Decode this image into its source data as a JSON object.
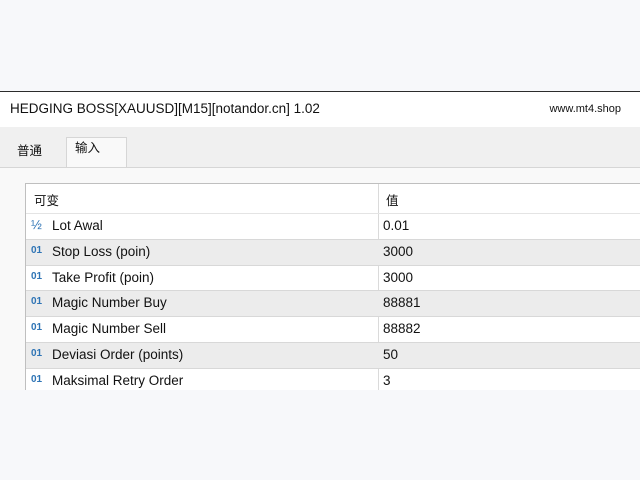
{
  "window": {
    "title": "HEDGING BOSS[XAUUSD][M15][notandor.cn] 1.02",
    "site": "www.mt4.shop"
  },
  "tabs": [
    {
      "label": "普通",
      "active": false
    },
    {
      "label": "输入",
      "active": true
    }
  ],
  "table": {
    "headers": {
      "name": "可变",
      "value": "值"
    },
    "rows": [
      {
        "icon": "½",
        "icon_name": "fraction-icon",
        "name": "Lot Awal",
        "value": "0.01"
      },
      {
        "icon": "01",
        "icon_name": "integer-icon",
        "name": "Stop Loss (poin)",
        "value": "3000"
      },
      {
        "icon": "01",
        "icon_name": "integer-icon",
        "name": "Take Profit (poin)",
        "value": "3000"
      },
      {
        "icon": "01",
        "icon_name": "integer-icon",
        "name": "Magic Number Buy",
        "value": "88881"
      },
      {
        "icon": "01",
        "icon_name": "integer-icon",
        "name": "Magic Number Sell",
        "value": "88882"
      },
      {
        "icon": "01",
        "icon_name": "integer-icon",
        "name": "Deviasi Order (points)",
        "value": "50"
      },
      {
        "icon": "01",
        "icon_name": "integer-icon",
        "name": "Maksimal Retry Order",
        "value": "3"
      }
    ]
  }
}
